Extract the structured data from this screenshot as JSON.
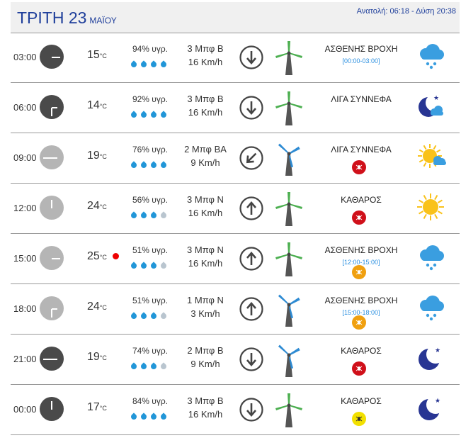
{
  "header": {
    "day": "ΤΡΙΤΗ 23",
    "month": "ΜΑΪΟΥ",
    "sun": "Ανατολή: 06:18 - Δύση 20:38"
  },
  "rows": [
    {
      "time": "03:00",
      "clock_type": "night",
      "clock_hour": 3,
      "temp": "15",
      "temp_unit": "°C",
      "hot_alert": false,
      "humidity": "94% υγρ.",
      "drops_active": 4,
      "wind_force": "3 Μπφ Β",
      "wind_speed": "16 Km/h",
      "wind_dir": "down",
      "condition": "ΑΣΘΕΝΗΣ ΒΡΟΧΗ",
      "rain_window": "[00:00-03:00]",
      "mosquito": "",
      "weather_icon": "cloud-rain-icon"
    },
    {
      "time": "06:00",
      "clock_type": "night",
      "clock_hour": 6,
      "temp": "14",
      "temp_unit": "°C",
      "hot_alert": false,
      "humidity": "92% υγρ.",
      "drops_active": 4,
      "wind_force": "3 Μπφ Β",
      "wind_speed": "16 Km/h",
      "wind_dir": "down",
      "condition": "ΛΙΓΑ ΣΥΝΝΕΦΑ",
      "rain_window": "",
      "mosquito": "",
      "weather_icon": "moon-cloud-icon"
    },
    {
      "time": "09:00",
      "clock_type": "day",
      "clock_hour": 9,
      "temp": "19",
      "temp_unit": "°C",
      "hot_alert": false,
      "humidity": "76% υγρ.",
      "drops_active": 4,
      "wind_force": "2 Μπφ ΒΑ",
      "wind_speed": "9 Km/h",
      "wind_dir": "down-left",
      "condition": "ΛΙΓΑ ΣΥΝΝΕΦΑ",
      "rain_window": "",
      "mosquito": "red",
      "weather_icon": "sun-cloud-icon"
    },
    {
      "time": "12:00",
      "clock_type": "day",
      "clock_hour": 12,
      "temp": "24",
      "temp_unit": "°C",
      "hot_alert": false,
      "humidity": "56% υγρ.",
      "drops_active": 3,
      "wind_force": "3 Μπφ Ν",
      "wind_speed": "16 Km/h",
      "wind_dir": "up",
      "condition": "ΚΑΘΑΡΟΣ",
      "rain_window": "",
      "mosquito": "red",
      "weather_icon": "sun-icon"
    },
    {
      "time": "15:00",
      "clock_type": "day",
      "clock_hour": 3,
      "temp": "25",
      "temp_unit": "°C",
      "hot_alert": true,
      "humidity": "51% υγρ.",
      "drops_active": 3,
      "wind_force": "3 Μπφ Ν",
      "wind_speed": "16 Km/h",
      "wind_dir": "up",
      "condition": "ΑΣΘΕΝΗΣ ΒΡΟΧΗ",
      "rain_window": "[12:00-15:00]",
      "mosquito": "orange",
      "weather_icon": "cloud-rain-icon"
    },
    {
      "time": "18:00",
      "clock_type": "day",
      "clock_hour": 6,
      "temp": "24",
      "temp_unit": "°C",
      "hot_alert": false,
      "humidity": "51% υγρ.",
      "drops_active": 3,
      "wind_force": "1 Μπφ Ν",
      "wind_speed": "3 Km/h",
      "wind_dir": "up",
      "condition": "ΑΣΘΕΝΗΣ ΒΡΟΧΗ",
      "rain_window": "[15:00-18:00]",
      "mosquito": "orange",
      "weather_icon": "cloud-rain-icon"
    },
    {
      "time": "21:00",
      "clock_type": "night",
      "clock_hour": 9,
      "temp": "19",
      "temp_unit": "°C",
      "hot_alert": false,
      "humidity": "74% υγρ.",
      "drops_active": 3,
      "wind_force": "2 Μπφ Β",
      "wind_speed": "9 Km/h",
      "wind_dir": "down",
      "condition": "ΚΑΘΑΡΟΣ",
      "rain_window": "",
      "mosquito": "red",
      "weather_icon": "moon-icon"
    },
    {
      "time": "00:00",
      "clock_type": "night",
      "clock_hour": 12,
      "temp": "17",
      "temp_unit": "°C",
      "hot_alert": false,
      "humidity": "84% υγρ.",
      "drops_active": 4,
      "wind_force": "3 Μπφ Β",
      "wind_speed": "16 Km/h",
      "wind_dir": "down",
      "condition": "ΚΑΘΑΡΟΣ",
      "rain_window": "",
      "mosquito": "yellow",
      "weather_icon": "moon-icon"
    }
  ],
  "colors": {
    "accent": "#1f3f9b",
    "drop_on": "#2196d8",
    "drop_off": "#b9c5cf",
    "rain_cloud": "#3a9ee0",
    "moon": "#283593",
    "sun": "#f9c21a",
    "windmill_pole": "#555555",
    "windmill_blade_green": "#4caf50",
    "windmill_blade_blue": "#2e8bd3"
  }
}
